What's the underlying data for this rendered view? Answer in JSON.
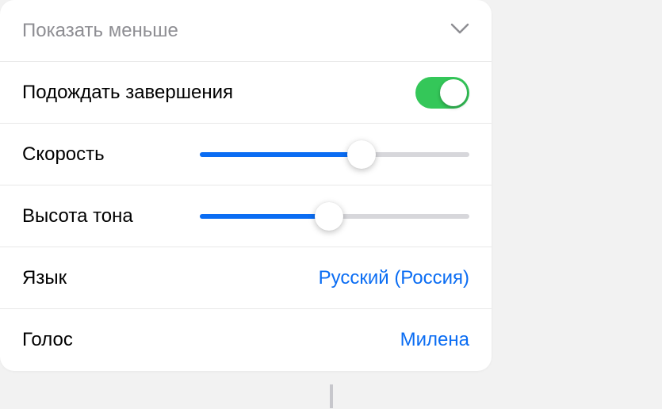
{
  "header": {
    "showLess": "Показать меньше"
  },
  "rows": {
    "waitCompletion": {
      "label": "Подождать завершения",
      "value": true
    },
    "speed": {
      "label": "Скорость",
      "value": 60
    },
    "pitch": {
      "label": "Высота тона",
      "value": 48
    },
    "language": {
      "label": "Язык",
      "value": "Русский (Россия)"
    },
    "voice": {
      "label": "Голос",
      "value": "Милена"
    }
  },
  "colors": {
    "accent": "#0b6df3",
    "toggleOn": "#34c759"
  }
}
